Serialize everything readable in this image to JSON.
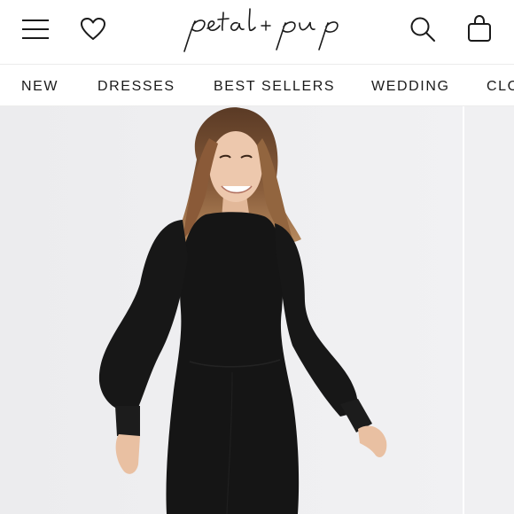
{
  "header": {
    "brand": "petal + pup",
    "icons": [
      "menu-icon",
      "heart-icon",
      "search-icon",
      "bag-icon"
    ]
  },
  "nav": {
    "items": [
      "NEW",
      "DRESSES",
      "BEST SELLERS",
      "WEDDING",
      "CLOTHING"
    ]
  },
  "hero": {
    "image": "model wearing black fuzzy long-sleeve mini dress",
    "colors": {
      "background": "#eeeeef",
      "dress": "#141414",
      "hair": "#7a5236",
      "skin": "#e8c3a8"
    }
  }
}
